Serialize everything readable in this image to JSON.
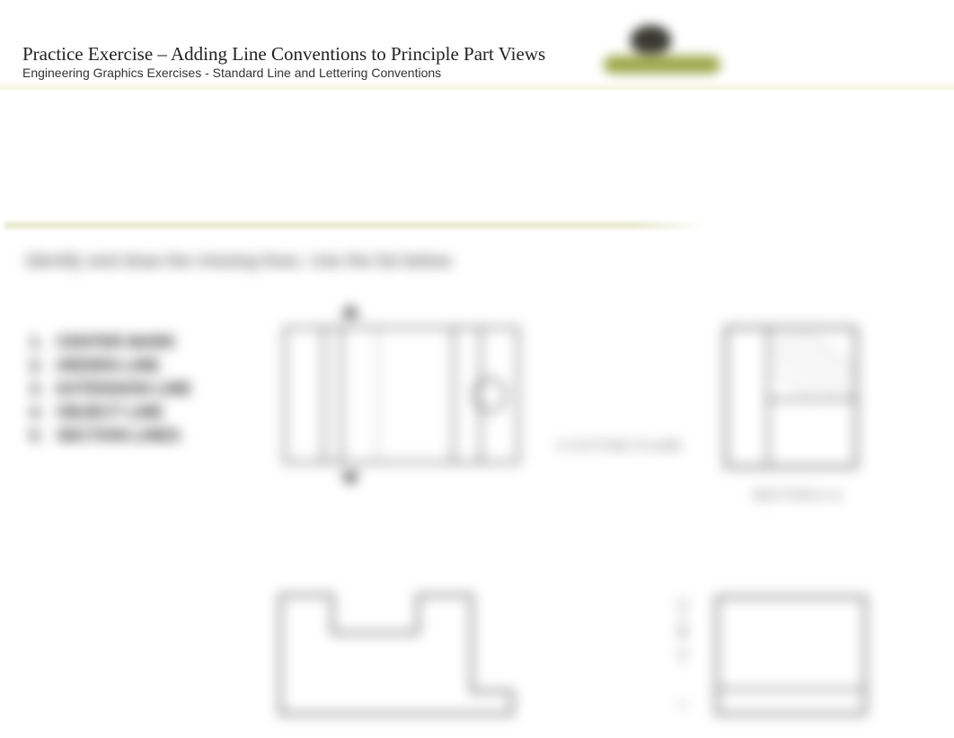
{
  "header": {
    "title": "Practice Exercise – Adding Line Conventions to Principle Part Views",
    "subtitle": "Engineering Graphics Exercises - Standard Line and Lettering Conventions"
  },
  "instruction": "Identify and draw the missing lines. Use the list below.",
  "legend": {
    "items": [
      {
        "num": "1.",
        "label": "CENTER MARK"
      },
      {
        "num": "2.",
        "label": "HIDDEN LINE"
      },
      {
        "num": "3.",
        "label": "EXTENSION LINE"
      },
      {
        "num": "4.",
        "label": "OBJECT LINE"
      },
      {
        "num": "5.",
        "label": "SECTION LINES"
      }
    ]
  },
  "labels": {
    "cutting_plane": "A CUTTING PLANE",
    "section": "SECTION A-A"
  }
}
